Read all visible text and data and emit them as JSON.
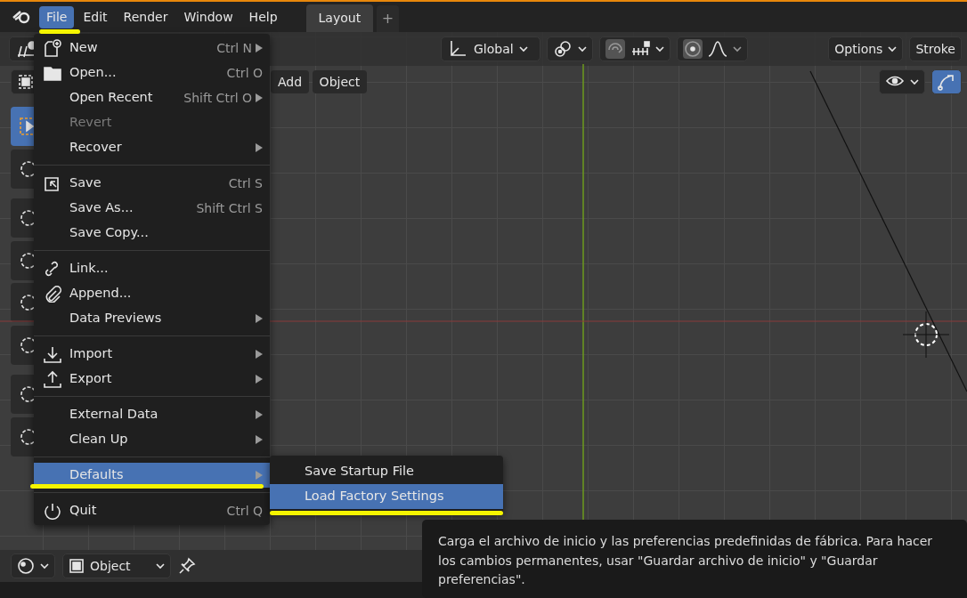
{
  "menubar": [
    {
      "label": "File",
      "selected": true
    },
    {
      "label": "Edit",
      "selected": false
    },
    {
      "label": "Render",
      "selected": false
    },
    {
      "label": "Window",
      "selected": false
    },
    {
      "label": "Help",
      "selected": false
    }
  ],
  "workspace_tabs": [
    {
      "label": "Layout",
      "selected": true
    }
  ],
  "add_tab": "+",
  "header": {
    "orientation": "Global",
    "options": "Options",
    "stroke": "Stroke"
  },
  "viewport_menus": [
    "Add",
    "Object"
  ],
  "file_menu": [
    [
      {
        "label": "New",
        "shortcut": "Ctrl N",
        "submenu": true,
        "disabled": false,
        "selected": false
      },
      {
        "label": "Open...",
        "shortcut": "Ctrl O",
        "submenu": false,
        "disabled": false,
        "selected": false
      },
      {
        "label": "Open Recent",
        "shortcut": "Shift Ctrl O",
        "submenu": true,
        "disabled": false,
        "selected": false
      },
      {
        "label": "Revert",
        "submenu": false,
        "disabled": true,
        "selected": false
      },
      {
        "label": "Recover",
        "submenu": true,
        "disabled": false,
        "selected": false
      }
    ],
    [
      {
        "label": "Save",
        "shortcut": "Ctrl S",
        "submenu": false,
        "disabled": false,
        "selected": false
      },
      {
        "label": "Save As...",
        "shortcut": "Shift Ctrl S",
        "submenu": false,
        "disabled": false,
        "selected": false
      },
      {
        "label": "Save Copy...",
        "submenu": false,
        "disabled": false,
        "selected": false
      }
    ],
    [
      {
        "label": "Link...",
        "submenu": false,
        "disabled": false,
        "selected": false
      },
      {
        "label": "Append...",
        "submenu": false,
        "disabled": false,
        "selected": false
      },
      {
        "label": "Data Previews",
        "submenu": true,
        "disabled": false,
        "selected": false
      }
    ],
    [
      {
        "label": "Import",
        "submenu": true,
        "disabled": false,
        "selected": false
      },
      {
        "label": "Export",
        "submenu": true,
        "disabled": false,
        "selected": false
      }
    ],
    [
      {
        "label": "External Data",
        "submenu": true,
        "disabled": false,
        "selected": false
      },
      {
        "label": "Clean Up",
        "submenu": true,
        "disabled": false,
        "selected": false
      }
    ],
    [
      {
        "label": "Defaults",
        "submenu": true,
        "disabled": false,
        "selected": true
      }
    ],
    [
      {
        "label": "Quit",
        "shortcut": "Ctrl Q",
        "submenu": false,
        "disabled": false,
        "selected": false
      }
    ]
  ],
  "defaults_submenu": [
    {
      "label": "Save Startup File",
      "selected": false
    },
    {
      "label": "Load Factory Settings",
      "selected": true
    }
  ],
  "tooltip": "Carga el archivo de inicio y las preferencias predefinidas de fábrica. Para hacer los cambios permanentes, usar \"Guardar archivo de inicio\" y \"Guardar preferencias\".",
  "footer": {
    "object": "Object"
  }
}
